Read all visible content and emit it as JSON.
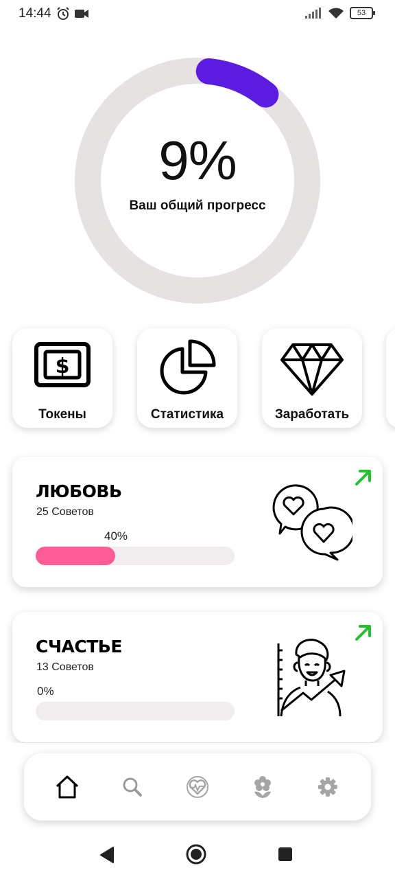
{
  "status_bar": {
    "time": "14:44",
    "battery": "53",
    "icons": [
      "alarm-icon",
      "video-camera-icon",
      "signal-icon",
      "wifi-icon",
      "battery-icon"
    ]
  },
  "progress": {
    "value": 0.09,
    "value_label": "9%",
    "label": "Ваш общий прогресс",
    "ring_color": "#5b1be0",
    "track_color": "#e6e2e2"
  },
  "tiles": [
    {
      "label": "Токены",
      "icon": "dollar-bill-icon"
    },
    {
      "label": "Статистика",
      "icon": "pie-chart-icon"
    },
    {
      "label": "Заработать",
      "icon": "diamond-icon"
    }
  ],
  "cards": [
    {
      "title": "ЛЮБОВЬ",
      "subtitle": "25 Советов",
      "progress": 0.4,
      "progress_label": "40%",
      "illustration": "hearts-chat-icon",
      "arrow": "trend-up-arrow-icon"
    },
    {
      "title": "СЧАСТЬЕ",
      "subtitle": "13 Советов",
      "progress": 0.0,
      "progress_label": "0%",
      "illustration": "happy-growth-person-icon",
      "arrow": "trend-up-arrow-icon"
    }
  ],
  "nav": {
    "items": [
      {
        "name": "home",
        "icon": "home-icon",
        "active": true
      },
      {
        "name": "search",
        "icon": "search-icon",
        "active": false
      },
      {
        "name": "health",
        "icon": "heart-pulse-icon",
        "active": false
      },
      {
        "name": "growth",
        "icon": "flower-icon",
        "active": false
      },
      {
        "name": "settings",
        "icon": "gear-icon",
        "active": false
      }
    ]
  },
  "colors": {
    "accent": "#5b1be0",
    "love_bar": "#fd5c97",
    "trend_arrow": "#22c22a"
  }
}
